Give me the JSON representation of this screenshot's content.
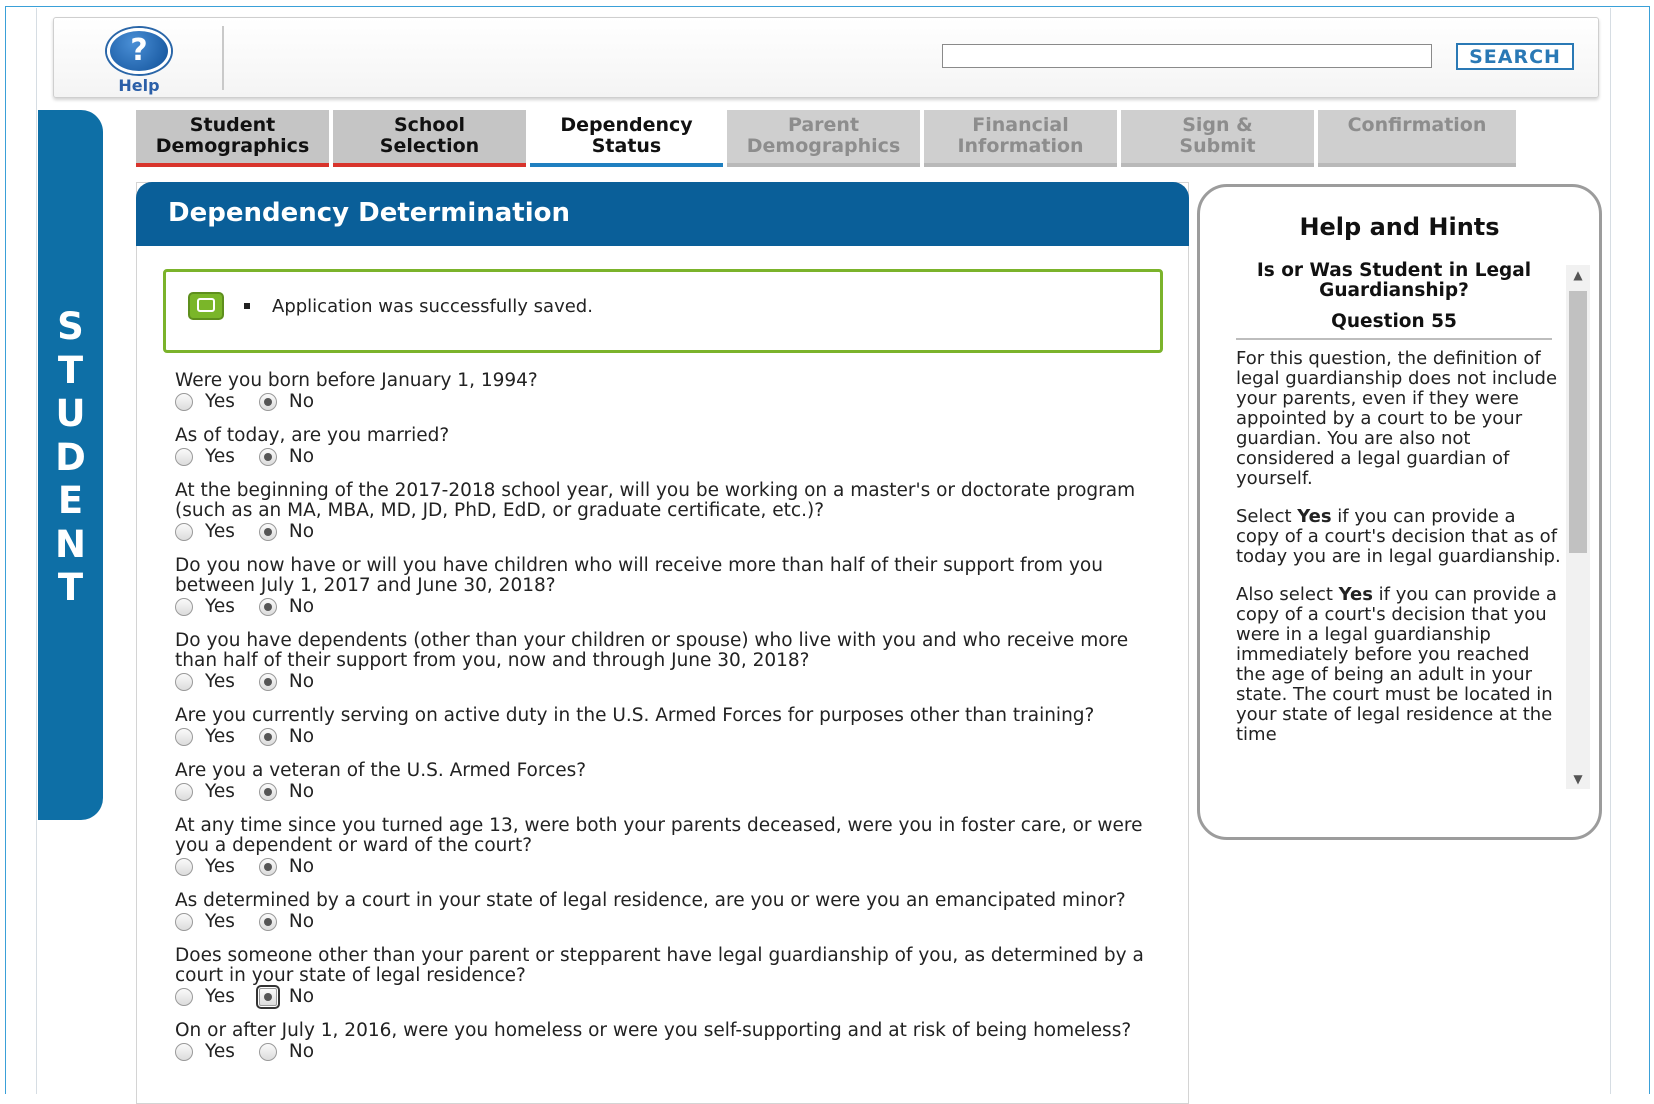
{
  "header": {
    "help_label": "Help",
    "help_glyph": "?",
    "search_placeholder": "",
    "search_button": "SEARCH"
  },
  "sidebar": {
    "letters": [
      "S",
      "T",
      "U",
      "D",
      "E",
      "N",
      "T"
    ]
  },
  "tabs": [
    {
      "line1": "Student",
      "line2": "Demographics",
      "state": "done"
    },
    {
      "line1": "School",
      "line2": "Selection",
      "state": "done"
    },
    {
      "line1": "Dependency",
      "line2": "Status",
      "state": "current"
    },
    {
      "line1": "Parent",
      "line2": "Demographics",
      "state": "future"
    },
    {
      "line1": "Financial",
      "line2": "Information",
      "state": "future"
    },
    {
      "line1": "Sign &",
      "line2": "Submit",
      "state": "future"
    },
    {
      "line1": "Confirmation",
      "line2": "",
      "state": "future"
    }
  ],
  "main": {
    "title": "Dependency Determination",
    "success_message": "Application was successfully saved.",
    "yes_label": "Yes",
    "no_label": "No",
    "questions": [
      {
        "text": "Were you born before January 1, 1994?",
        "selected": "no"
      },
      {
        "text": "As of today, are you married?",
        "selected": "no"
      },
      {
        "text": "At the beginning of the 2017-2018 school year, will you be working on a master's or doctorate program (such as an MA, MBA, MD, JD, PhD, EdD, or graduate certificate, etc.)?",
        "selected": "no"
      },
      {
        "text": "Do you now have or will you have children who will receive more than half of their support from you between July 1, 2017 and June 30, 2018?",
        "selected": "no"
      },
      {
        "text": "Do you have dependents (other than your children or spouse) who live with you and who receive more than half of their support from you, now and through June 30, 2018?",
        "selected": "no"
      },
      {
        "text": "Are you currently serving on active duty in the U.S. Armed Forces for purposes other than training?",
        "selected": "no"
      },
      {
        "text": "Are you a veteran of the U.S. Armed Forces?",
        "selected": "no"
      },
      {
        "text": "At any time since you turned age 13, were both your parents deceased, were you in foster care, or were you a dependent or ward of the court?",
        "selected": "no"
      },
      {
        "text": "As determined by a court in your state of legal residence, are you or were you an emancipated minor?",
        "selected": "no"
      },
      {
        "text": "Does someone other than your parent or stepparent have legal guardianship of you, as determined by a court in your state of legal residence?",
        "selected": "no",
        "focused": true
      },
      {
        "text": "On or after July 1, 2016, were you homeless or were you self-supporting and at risk of being homeless?",
        "selected": "none"
      }
    ]
  },
  "help_panel": {
    "title": "Help and Hints",
    "subtitle": "Is or Was Student in Legal Guardianship?",
    "question_number": "Question 55",
    "p1": "For this question, the definition of legal guardianship does not include your parents, even if they were appointed by a court to be your guardian. You are also not considered a legal guardian of yourself.",
    "p2_before": "Select ",
    "p2_bold": "Yes",
    "p2_after": " if you can provide a copy of a court's decision that as of today you are in legal guardianship.",
    "p3_before": "Also select ",
    "p3_bold": "Yes",
    "p3_after": " if you can provide a copy of a court's decision that you were in a legal guardianship immediately before you reached the age of being an adult in your state. The court must be located in your state of legal residence at the time"
  },
  "colors": {
    "brand_blue": "#0a5f99",
    "sidebar_blue": "#0e6fa6",
    "success_green": "#7bb32b",
    "tab_done_underline": "#d8342c",
    "tab_current_underline": "#1f7fc0"
  }
}
